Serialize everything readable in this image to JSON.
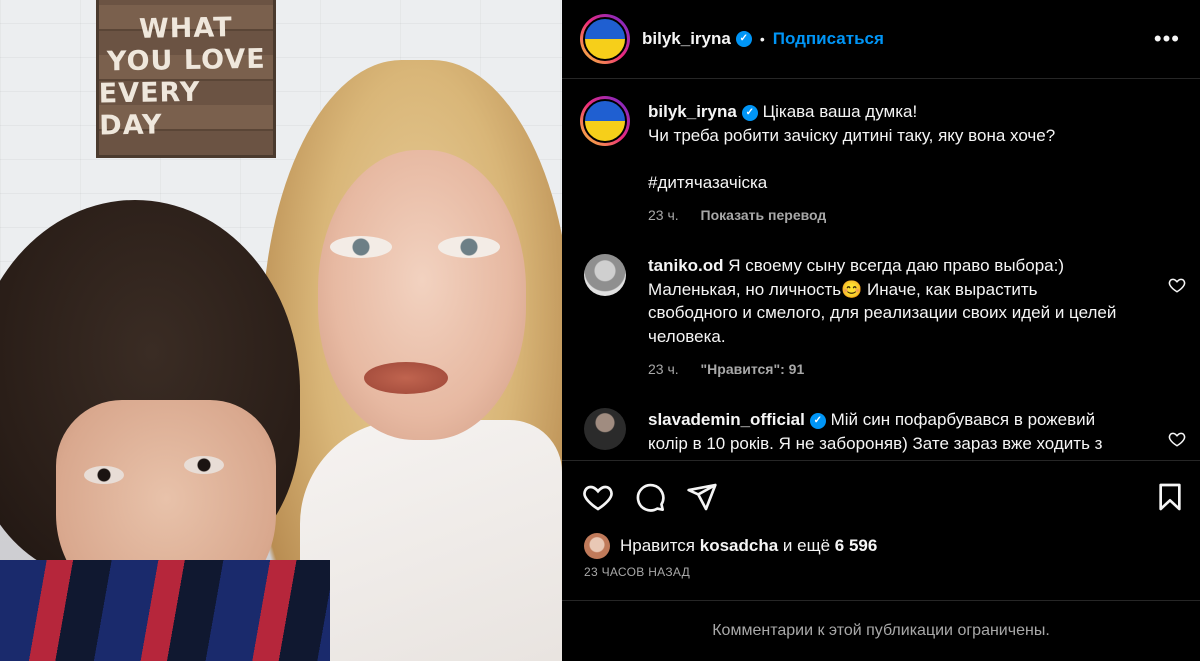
{
  "post_author": {
    "username": "bilyk_iryna",
    "verified": true,
    "follow_label": "Подписаться",
    "more_label": "•••"
  },
  "photo": {
    "sign_lines": [
      "WHAT",
      "YOU LOVE",
      "EVERY DAY"
    ]
  },
  "caption": {
    "username": "bilyk_iryna",
    "lines": [
      "Цікава ваша думка!",
      "Чи треба робити зачіску дитині таку, яку вона хоче?",
      "",
      "#дитячазачіска"
    ],
    "time": "23 ч.",
    "translate_label": "Показать перевод"
  },
  "comments": [
    {
      "username": "taniko.od",
      "verified": false,
      "text_lines": [
        "Я своему сыну всегда даю право выбора:)",
        "Маленькая, но личность😊 Иначе, как вырастить",
        "свободного и смелого, для реализации своих идей и целей",
        "человека."
      ],
      "time": "23 ч.",
      "likes_label": "\"Нравится\": 91"
    },
    {
      "username": "slavademin_official",
      "verified": true,
      "text_lines": [
        "Мій син пофарбувався в рожевий",
        "колір в 10 років. Я не забороняв) Зате зараз вже ходить з"
      ]
    }
  ],
  "actions": {
    "liked_by_prefix": "Нравится",
    "liked_by_user": "kosadcha",
    "liked_by_suffix": "и ещё",
    "likes_count": "6 596",
    "timestamp": "23 ЧАСОВ НАЗАД"
  },
  "footer": {
    "comments_restricted": "Комментарии к этой публикации ограничены."
  },
  "colors": {
    "accent": "#0095f6",
    "background": "#000000",
    "muted": "#a8a8a8",
    "divider": "#262626"
  }
}
